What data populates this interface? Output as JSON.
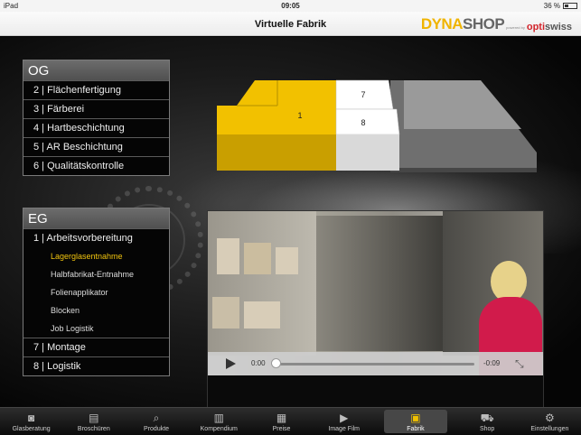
{
  "status": {
    "device": "iPad",
    "time": "09:05",
    "battery": "36 %",
    "battery_fraction": 0.36
  },
  "nav": {
    "title": "Virtuelle Fabrik",
    "logo_dyna": "DYNA",
    "logo_shop": "SHOP",
    "logo_powered": "powered by",
    "logo_opti": "opti",
    "logo_swiss": "swiss"
  },
  "og": {
    "header": "OG",
    "items": [
      "2 | Flächenfertigung",
      "3 | Färberei",
      "4 | Hartbeschichtung",
      "5 | AR Beschichtung",
      "6 | Qualitätskontrolle"
    ]
  },
  "eg": {
    "header": "EG",
    "section": "1 | Arbeitsvorbereitung",
    "subitems": [
      "Lagerglasentnahme",
      "Halbfabrikat-Entnahme",
      "Folienapplikator",
      "Blocken",
      "Job Logistik"
    ],
    "active_subitem": 0,
    "items": [
      "7 | Montage",
      "8 | Logistik"
    ]
  },
  "plan": {
    "room_1": "1",
    "room_7": "7",
    "room_8": "8",
    "highlight_color": "#f2c100"
  },
  "video": {
    "time_current": "0:00",
    "time_remaining": "-0:09",
    "progress": 0.0
  },
  "tabs": [
    {
      "label": "Glasberatung",
      "icon": "glasses-icon"
    },
    {
      "label": "Broschüren",
      "icon": "document-icon"
    },
    {
      "label": "Produkte",
      "icon": "magnifier-icon"
    },
    {
      "label": "Kompendium",
      "icon": "book-icon"
    },
    {
      "label": "Preise",
      "icon": "calculator-icon"
    },
    {
      "label": "Image Film",
      "icon": "play-icon"
    },
    {
      "label": "Fabrik",
      "icon": "factory-icon"
    },
    {
      "label": "Shop",
      "icon": "cart-icon"
    },
    {
      "label": "Einstellungen",
      "icon": "gears-icon"
    }
  ],
  "active_tab": 6
}
